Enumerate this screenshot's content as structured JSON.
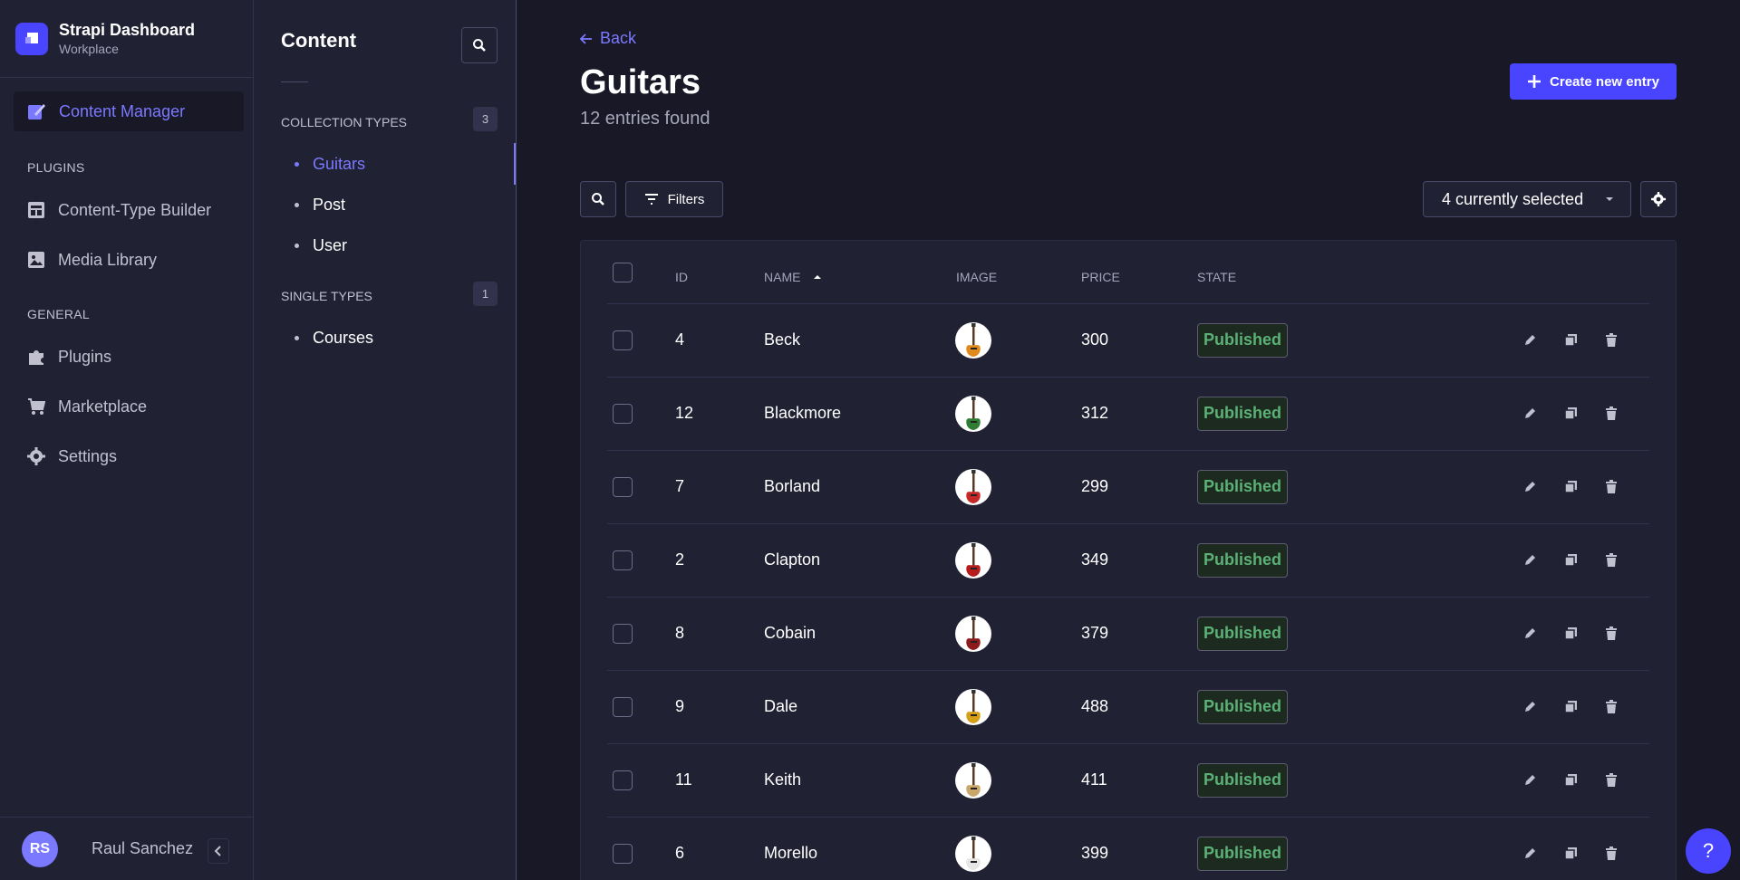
{
  "brand": {
    "title": "Strapi Dashboard",
    "subtitle": "Workplace",
    "accent": "#4945ff"
  },
  "mainnav": {
    "active": {
      "label": "Content Manager",
      "icon": "feather-pen-icon"
    },
    "sections": [
      {
        "label": "PLUGINS",
        "items": [
          {
            "label": "Content-Type Builder",
            "icon": "layout-icon"
          },
          {
            "label": "Media Library",
            "icon": "image-icon"
          }
        ]
      },
      {
        "label": "GENERAL",
        "items": [
          {
            "label": "Plugins",
            "icon": "puzzle-icon"
          },
          {
            "label": "Marketplace",
            "icon": "cart-icon"
          },
          {
            "label": "Settings",
            "icon": "gear-icon"
          }
        ]
      }
    ],
    "user": {
      "initials": "RS",
      "name": "Raul Sanchez"
    }
  },
  "subnav": {
    "title": "Content",
    "collection": {
      "label": "COLLECTION TYPES",
      "count": "3",
      "items": [
        "Guitars",
        "Post",
        "User"
      ]
    },
    "single": {
      "label": "SINGLE TYPES",
      "count": "1",
      "items": [
        "Courses"
      ]
    }
  },
  "main": {
    "back": "Back",
    "title": "Guitars",
    "subtitle": "12 entries found",
    "create": "Create new entry",
    "filters": "Filters",
    "selected": "4 currently selected",
    "columns": {
      "id": "ID",
      "name": "NAME",
      "image": "IMAGE",
      "price": "PRICE",
      "state": "STATE"
    },
    "rows": [
      {
        "id": "4",
        "name": "Beck",
        "price": "300",
        "state": "Published",
        "guitar_color": "#e08a1e"
      },
      {
        "id": "12",
        "name": "Blackmore",
        "price": "312",
        "state": "Published",
        "guitar_color": "#2e7d32"
      },
      {
        "id": "7",
        "name": "Borland",
        "price": "299",
        "state": "Published",
        "guitar_color": "#c62828"
      },
      {
        "id": "2",
        "name": "Clapton",
        "price": "349",
        "state": "Published",
        "guitar_color": "#b71c1c"
      },
      {
        "id": "8",
        "name": "Cobain",
        "price": "379",
        "state": "Published",
        "guitar_color": "#8e1b1b"
      },
      {
        "id": "9",
        "name": "Dale",
        "price": "488",
        "state": "Published",
        "guitar_color": "#d4a017"
      },
      {
        "id": "11",
        "name": "Keith",
        "price": "411",
        "state": "Published",
        "guitar_color": "#c9a86a"
      },
      {
        "id": "6",
        "name": "Morello",
        "price": "399",
        "state": "Published",
        "guitar_color": "#e6e6e6"
      }
    ]
  },
  "help": "?"
}
